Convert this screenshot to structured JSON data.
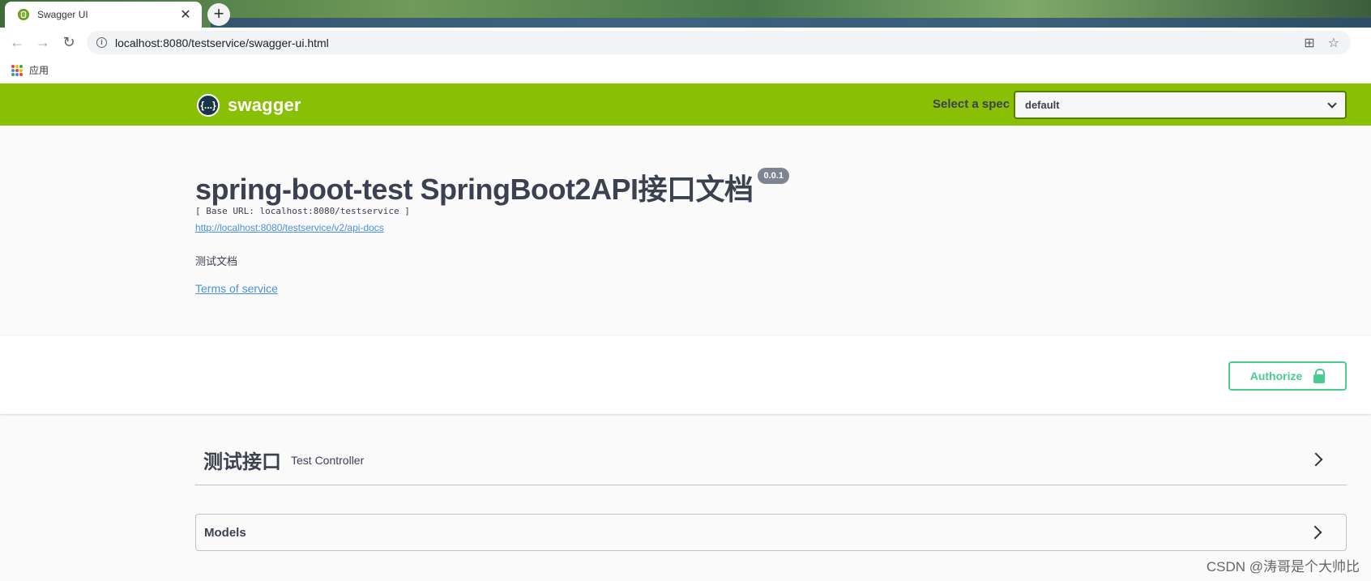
{
  "browser": {
    "tab_title": "Swagger UI",
    "tab_close": "✕",
    "new_tab": "+",
    "url": "localhost:8080/testservice/swagger-ui.html",
    "bookmarks_label": "应用"
  },
  "topbar": {
    "logo_glyph": "{...}",
    "logo_text": "swagger",
    "spec_label": "Select a spec",
    "spec_value": "default"
  },
  "info": {
    "title": "spring-boot-test SpringBoot2API接口文档",
    "version": "0.0.1",
    "base_url": "[ Base URL: localhost:8080/testservice ]",
    "docs_link": "http://localhost:8080/testservice/v2/api-docs",
    "description": "测试文档",
    "terms": "Terms of service"
  },
  "authorize": {
    "label": "Authorize"
  },
  "tag": {
    "name": "测试接口",
    "description": "Test Controller"
  },
  "models": {
    "label": "Models"
  },
  "watermark": "CSDN @涛哥是个大帅比",
  "colors": {
    "topbar": "#89bf04",
    "authorize": "#49cc90",
    "link": "#4990e2",
    "text": "#3b4151"
  },
  "icons": [
    "back-arrow-icon",
    "forward-arrow-icon",
    "reload-icon",
    "info-icon",
    "translate-icon",
    "star-icon",
    "apps-icon",
    "lock-icon",
    "chevron-down-icon",
    "chevron-right-icon"
  ]
}
